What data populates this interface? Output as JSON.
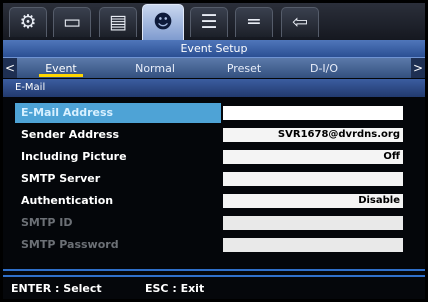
{
  "icon_tabs": [
    {
      "name": "gear-icon",
      "glyph": "⚙",
      "active": false
    },
    {
      "name": "display-icon",
      "glyph": "▭",
      "active": false
    },
    {
      "name": "hdd-icon",
      "glyph": "▤",
      "active": false
    },
    {
      "name": "users-icon",
      "glyph": "☻",
      "active": true
    },
    {
      "name": "network-icon",
      "glyph": "☰",
      "active": false
    },
    {
      "name": "remote-icon",
      "glyph": "═",
      "active": false
    },
    {
      "name": "exit-icon",
      "glyph": "⇦",
      "active": false
    }
  ],
  "title": "Event Setup",
  "sub_tabs": {
    "left_arrow": "<",
    "right_arrow": ">",
    "items": [
      {
        "label": "Event",
        "active": true
      },
      {
        "label": "Normal",
        "active": false
      },
      {
        "label": "Preset",
        "active": false
      },
      {
        "label": "D-I/O",
        "active": false
      }
    ]
  },
  "section": "E-Mail",
  "fields": [
    {
      "label": "E-Mail Address",
      "value": "",
      "selected": true,
      "disabled": false
    },
    {
      "label": "Sender Address",
      "value": "SVR1678@dvrdns.org",
      "selected": false,
      "disabled": false
    },
    {
      "label": "Including Picture",
      "value": "Off",
      "selected": false,
      "disabled": false
    },
    {
      "label": "SMTP Server",
      "value": "",
      "selected": false,
      "disabled": false
    },
    {
      "label": "Authentication",
      "value": "Disable",
      "selected": false,
      "disabled": false
    },
    {
      "label": "SMTP ID",
      "value": "",
      "selected": false,
      "disabled": true
    },
    {
      "label": "SMTP Password",
      "value": "",
      "selected": false,
      "disabled": true
    }
  ],
  "footer": {
    "select": "ENTER : Select",
    "exit": "ESC : Exit"
  },
  "colors": {
    "accent": "#2f6fc9",
    "selection": "#4ea3d6",
    "active_tab_underline": "#ffd600"
  }
}
